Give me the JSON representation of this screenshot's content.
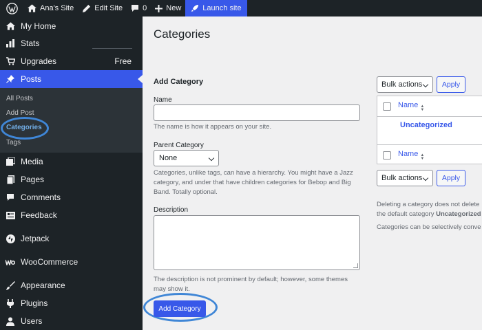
{
  "adminbar": {
    "site_name": "Ana's Site",
    "edit_site": "Edit Site",
    "comments_count": "0",
    "new_label": "New",
    "launch_label": "Launch site"
  },
  "sidebar": {
    "items": [
      {
        "label": "My Home",
        "icon": "home-icon"
      },
      {
        "label": "Stats",
        "icon": "stats-icon"
      },
      {
        "label": "Upgrades",
        "icon": "cart-icon",
        "badge": "Free"
      },
      {
        "label": "Posts",
        "icon": "pin-icon"
      },
      {
        "label": "Media",
        "icon": "media-icon"
      },
      {
        "label": "Pages",
        "icon": "pages-icon"
      },
      {
        "label": "Comments",
        "icon": "comments-icon"
      },
      {
        "label": "Feedback",
        "icon": "feedback-icon"
      },
      {
        "label": "Jetpack",
        "icon": "jetpack-icon"
      },
      {
        "label": "WooCommerce",
        "icon": "woo-icon"
      },
      {
        "label": "Appearance",
        "icon": "brush-icon"
      },
      {
        "label": "Plugins",
        "icon": "plug-icon"
      },
      {
        "label": "Users",
        "icon": "user-icon"
      }
    ],
    "submenu": [
      "All Posts",
      "Add Post",
      "Categories",
      "Tags"
    ]
  },
  "main": {
    "title": "Categories",
    "form_heading": "Add Category",
    "name_label": "Name",
    "name_desc": "The name is how it appears on your site.",
    "parent_label": "Parent Category",
    "parent_value": "None",
    "parent_desc": "Categories, unlike tags, can have a hierarchy. You might have a Jazz category, and under that have children categories for Bebop and Big Band. Totally optional.",
    "description_label": "Description",
    "description_desc": "The description is not prominent by default; however, some themes may show it.",
    "add_button": "Add Category"
  },
  "list": {
    "bulk_actions": "Bulk actions",
    "apply": "Apply",
    "column_name": "Name",
    "rows": [
      "Uncategorized"
    ],
    "note_line1": "Deleting a category does not delete",
    "note_line2_prefix": "the default category ",
    "note_line2_bold": "Uncategorized",
    "note_line3": "Categories can be selectively conve"
  },
  "colors": {
    "accent": "#3858e9",
    "sidebar_bg": "#1d2327",
    "highlight_ring": "#3f86d6"
  }
}
